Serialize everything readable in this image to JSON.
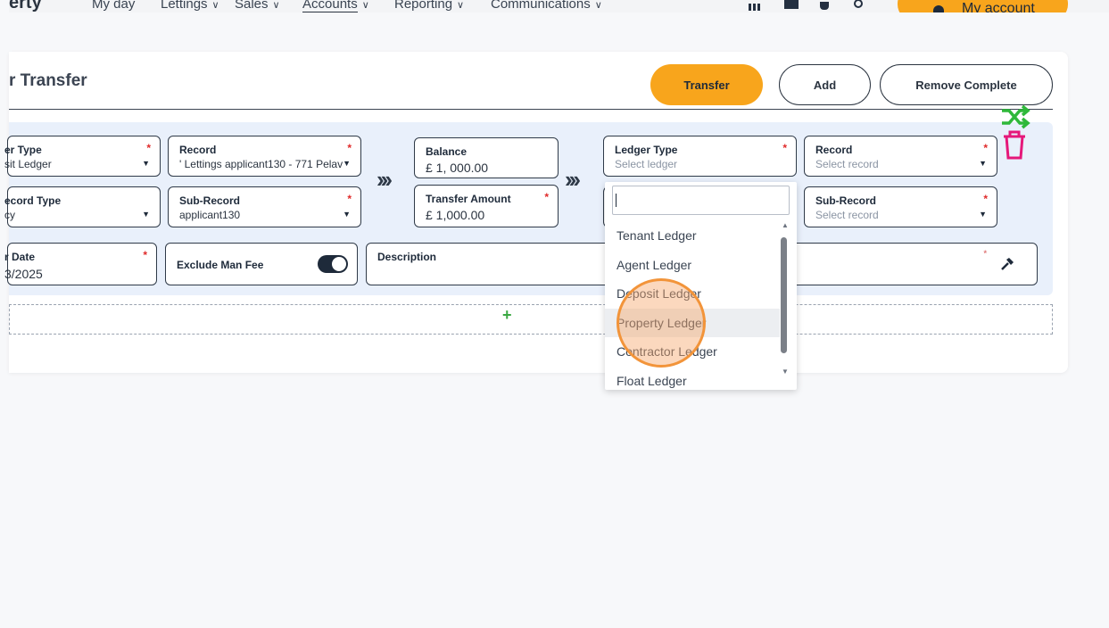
{
  "nav": {
    "brand": "erty",
    "items": [
      {
        "label": "My day",
        "chevron": false
      },
      {
        "label": "Lettings",
        "chevron": true
      },
      {
        "label": "Sales",
        "chevron": true
      },
      {
        "label": "Accounts",
        "chevron": true
      },
      {
        "label": "Reporting",
        "chevron": true
      },
      {
        "label": "Communications",
        "chevron": true
      }
    ],
    "account_label": "My account"
  },
  "page": {
    "title": "r Transfer",
    "transfer_label": "Transfer",
    "add_label": "Add",
    "remove_complete_label": "Remove Complete"
  },
  "source": {
    "ledger_type_label": "er Type",
    "ledger_type_value": "sit Ledger",
    "record_label": "Record",
    "record_value": "' Lettings applicant130 - 771 Pelav",
    "sub_record_type_label": "ecord Type",
    "sub_record_type_value": "cy",
    "sub_record_label": "Sub-Record",
    "sub_record_value": "applicant130",
    "date_label": "r Date",
    "date_value": "3/2025",
    "exclude_fee_label": "Exclude Man Fee",
    "exclude_fee_on": true,
    "description_label": "Description"
  },
  "amounts": {
    "balance_label": "Balance",
    "balance_value": "£ 1, 000.00",
    "transfer_amount_label": "Transfer Amount",
    "transfer_amount_value": "£ 1,000.00"
  },
  "target": {
    "ledger_type_label": "Ledger Type",
    "ledger_type_placeholder": "Select ledger",
    "record_label": "Record",
    "record_placeholder": "Select record",
    "sub_record_label": "Sub-Record",
    "sub_record_placeholder": "Select record"
  },
  "required_mark": "*",
  "dropdown": {
    "search_value": "",
    "options": [
      "Tenant Ledger",
      "Agent Ledger",
      "Deposit Ledger",
      "Property Ledger",
      "Contractor Ledger",
      "Float Ledger"
    ],
    "highlighted": "Property Ledger"
  },
  "icons": {
    "shuffle": "shuffle-icon",
    "trash": "trash-icon",
    "hammer": "hammer-icon",
    "plus": "+"
  },
  "colors": {
    "accent": "#f8a51c",
    "panel": "#e9f0fb",
    "shuffle": "#2fb83a",
    "trash": "#e5187a",
    "required": "#e02a2a",
    "add_plus": "#3aa842"
  }
}
